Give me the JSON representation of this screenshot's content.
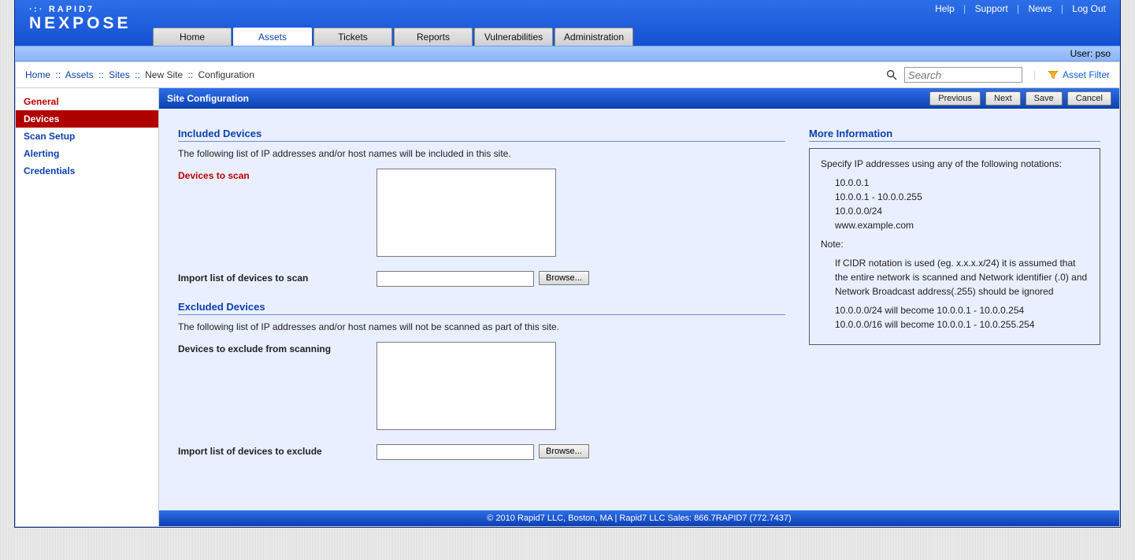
{
  "toplinks": {
    "help": "Help",
    "support": "Support",
    "news": "News",
    "logout": "Log Out"
  },
  "brand": {
    "line1": "∙:∙ RAPID7",
    "line2": "NEXPOSE"
  },
  "tabs": [
    "Home",
    "Assets",
    "Tickets",
    "Reports",
    "Vulnerabilities",
    "Administration"
  ],
  "subbar_user": "User: pso",
  "breadcrumb": {
    "home": "Home",
    "assets": "Assets",
    "sites": "Sites",
    "newsite": "New Site",
    "config": "Configuration"
  },
  "search": {
    "placeholder": "Search"
  },
  "assetfilter": "Asset Filter",
  "sidenav": [
    "General",
    "Devices",
    "Scan Setup",
    "Alerting",
    "Credentials"
  ],
  "panel": {
    "title": "Site Configuration",
    "buttons": {
      "previous": "Previous",
      "next": "Next",
      "save": "Save",
      "cancel": "Cancel"
    }
  },
  "included": {
    "title": "Included Devices",
    "desc": "The following list of IP addresses and/or host names will be included in this site.",
    "devices_label": "Devices to scan",
    "import_label": "Import list of devices to scan",
    "browse": "Browse..."
  },
  "excluded": {
    "title": "Excluded Devices",
    "desc": "The following list of IP addresses and/or host names will not be scanned as part of this site.",
    "devices_label": "Devices to exclude from scanning",
    "import_label": "Import list of devices to exclude",
    "browse": "Browse..."
  },
  "moreinfo": {
    "title": "More Information",
    "intro": "Specify IP addresses using any of the following notations:",
    "examples": [
      "10.0.0.1",
      "10.0.0.1 - 10.0.0.255",
      "10.0.0.0/24",
      "www.example.com"
    ],
    "note_label": "Note:",
    "note_body": "If CIDR notation is used (eg. x.x.x.x/24) it is assumed that the entire network is scanned and Network identifier (.0) and Network Broadcast address(.255) should be ignored",
    "note_ex": [
      "10.0.0.0/24 will become 10.0.0.1 - 10.0.0.254",
      "10.0.0.0/16 will become 10.0.0.1 - 10.0.255.254"
    ]
  },
  "footer": "© 2010 Rapid7 LLC, Boston, MA | Rapid7 LLC Sales: 866.7RAPID7 (772.7437)"
}
